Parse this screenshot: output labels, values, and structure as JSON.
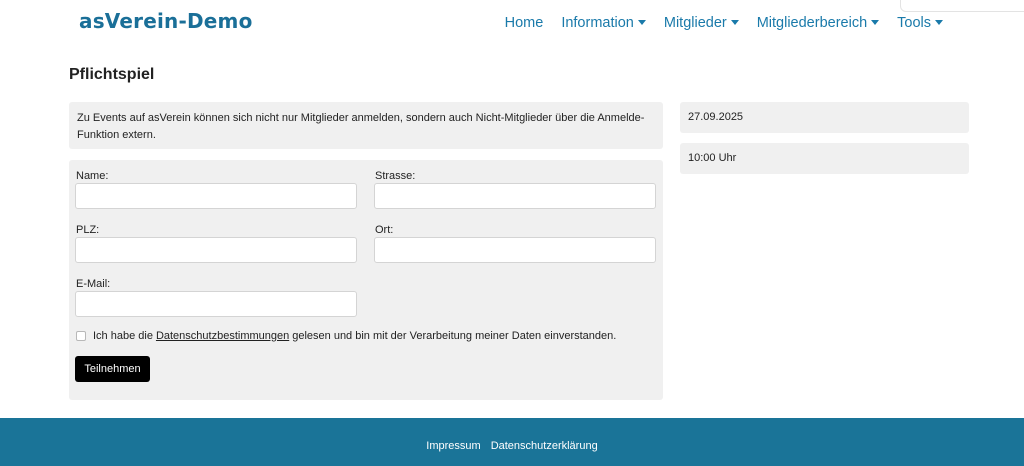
{
  "header": {
    "brand": "asVerein-Demo",
    "nav": [
      {
        "label": "Home",
        "dropdown": false
      },
      {
        "label": "Information",
        "dropdown": true
      },
      {
        "label": "Mitglieder",
        "dropdown": true
      },
      {
        "label": "Mitgliederbereich",
        "dropdown": true
      },
      {
        "label": "Tools",
        "dropdown": true
      }
    ]
  },
  "page": {
    "title": "Pflichtspiel",
    "info_text": "Zu Events auf asVerein können sich nicht nur Mitglieder anmelden, sondern auch Nicht-Mitglieder über die Anmelde-Funktion extern."
  },
  "form": {
    "name_label": "Name:",
    "strasse_label": "Strasse:",
    "plz_label": "PLZ:",
    "ort_label": "Ort:",
    "email_label": "E-Mail:",
    "consent_before": "Ich habe die",
    "consent_link": "Datenschutzbestimmungen",
    "consent_after": "gelesen und bin mit der Verarbeitung meiner Daten einverstanden.",
    "submit_label": "Teilnehmen",
    "values": {
      "name": "",
      "strasse": "",
      "plz": "",
      "ort": "",
      "email": ""
    }
  },
  "event": {
    "date": "27.09.2025",
    "time": "10:00 Uhr"
  },
  "footer": {
    "impressum": "Impressum",
    "datenschutz": "Datenschutzerklärung"
  },
  "colors": {
    "brand": "#1a6f98",
    "nav_link": "#1a7aaa",
    "footer_bg": "#1a7498",
    "panel_bg": "#f0f0f0",
    "button_bg": "#000000"
  }
}
